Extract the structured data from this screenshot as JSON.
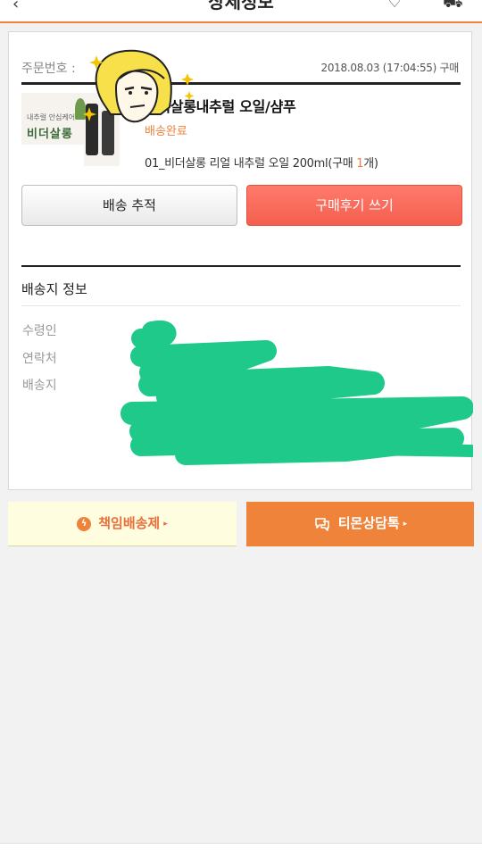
{
  "header": {
    "back_icon": "back-arrow-icon",
    "title": "상세정보",
    "heart_icon": "heart-icon",
    "cart_icon": "cart-icon"
  },
  "order": {
    "number_label": "주문번호 :",
    "date": "2018.08.03 (17:04:55) 구매"
  },
  "product": {
    "thumb_line1": "내추럴 안심케어",
    "thumb_line2": "비더살롱",
    "name": "비더살롱내추럴 오일/샴푸",
    "status": "배송완료",
    "option_prefix": "01_비더살롱 리얼 내추럴 오일 200ml(구매 ",
    "quantity": "1",
    "option_suffix": "개)"
  },
  "buttons": {
    "track": "배송 추적",
    "review": "구매후기 쓰기"
  },
  "shipping": {
    "title": "배송지 정보",
    "recipient_label": "수령인",
    "contact_label": "연락처",
    "address_label": "배송지"
  },
  "bottom_actions": {
    "delivery": "책임배송제",
    "chat": "티몬상담톡"
  },
  "colors": {
    "accent": "#f0833a",
    "review_button": "#f45f4f",
    "redaction": "#1ec98a"
  }
}
